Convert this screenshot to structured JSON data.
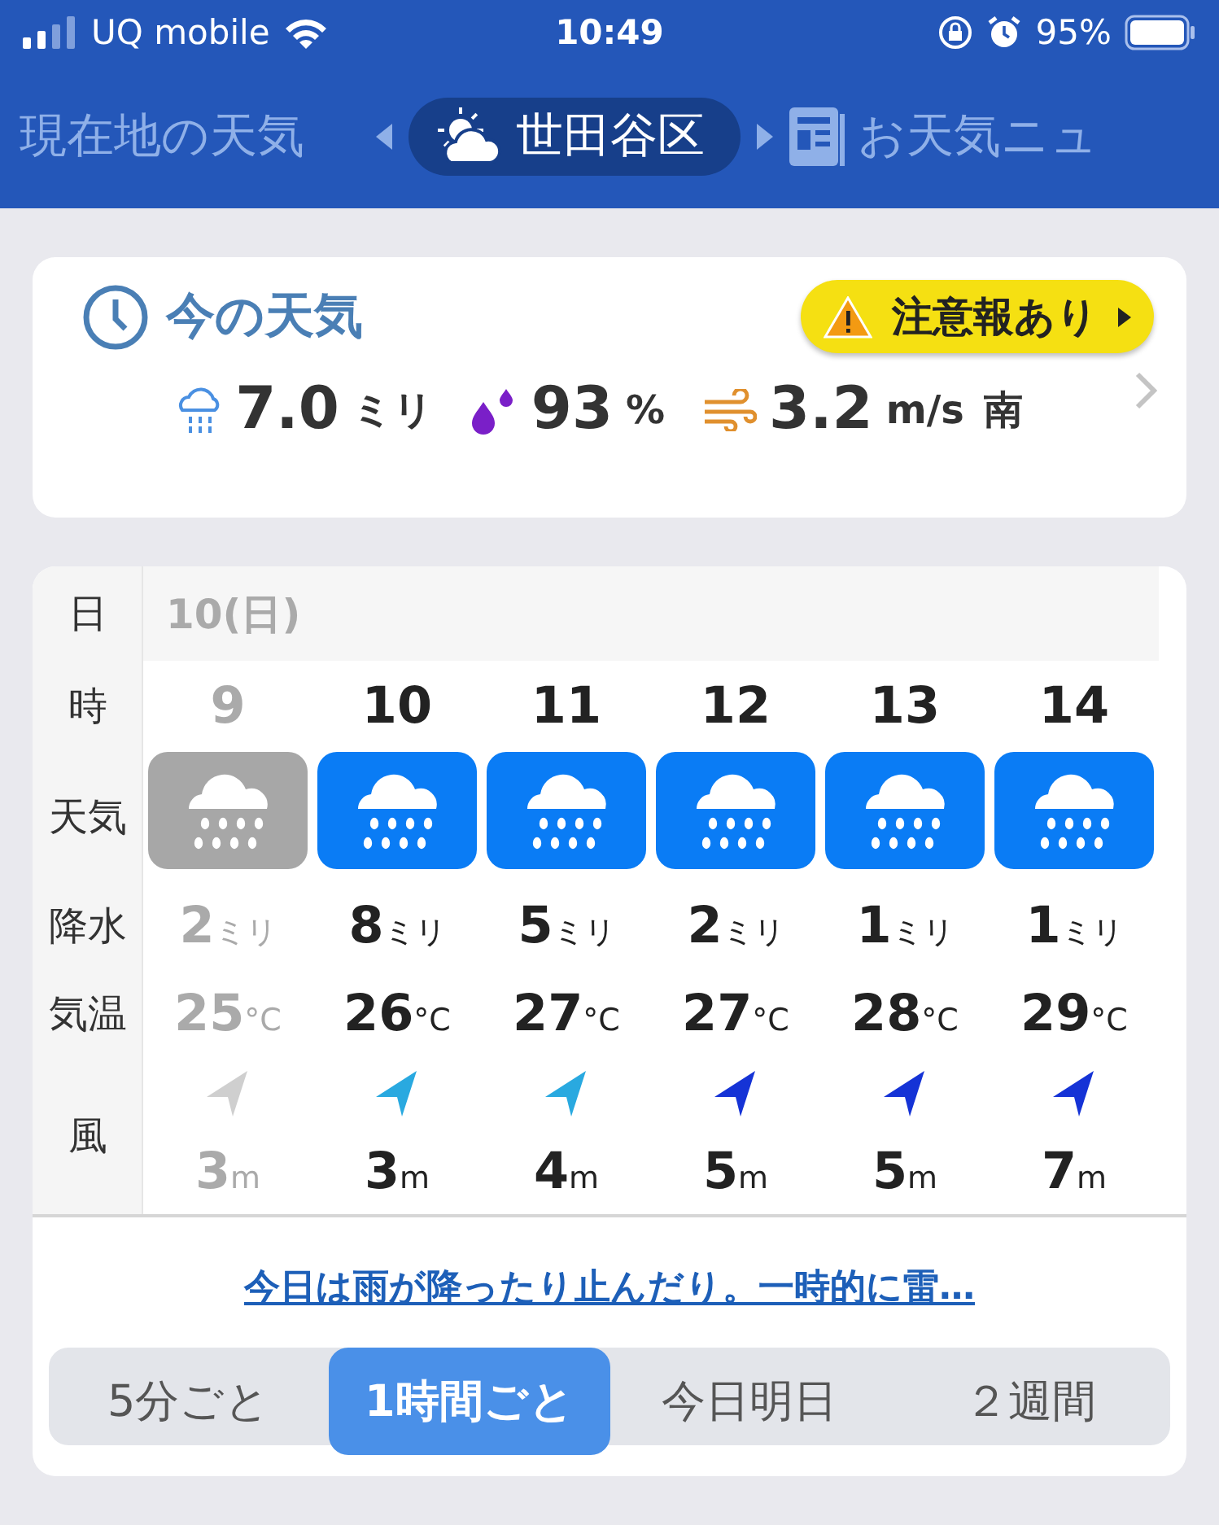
{
  "status_bar": {
    "carrier": "UQ mobile",
    "time": "10:49",
    "battery": "95%"
  },
  "location_tabs": [
    {
      "label": "現在地の天気",
      "kind": "text",
      "selected": false
    },
    {
      "label": "世田谷区",
      "kind": "weather",
      "selected": true
    },
    {
      "label": "お天気ニュ",
      "kind": "news",
      "selected": false
    }
  ],
  "current": {
    "title": "今の天気",
    "alert": "注意報あり",
    "precip": {
      "value": "7.0",
      "unit": "ミリ"
    },
    "humidity": {
      "value": "93",
      "unit": "%"
    },
    "wind": {
      "value": "3.2",
      "unit": "m/s",
      "direction": "南"
    }
  },
  "table": {
    "row_labels": [
      "日",
      "時",
      "天気",
      "降水",
      "気温",
      "風"
    ],
    "date": "10(日)",
    "hours": [
      {
        "hour": "9",
        "past": true,
        "precip": "2",
        "precip_unit": "ミリ",
        "temp": "25",
        "temp_unit": "°C",
        "wind": "3",
        "wind_unit": "m",
        "color": "#cfcfcf"
      },
      {
        "hour": "10",
        "past": false,
        "precip": "8",
        "precip_unit": "ミリ",
        "temp": "26",
        "temp_unit": "°C",
        "wind": "3",
        "wind_unit": "m",
        "color": "#29a9e0"
      },
      {
        "hour": "11",
        "past": false,
        "precip": "5",
        "precip_unit": "ミリ",
        "temp": "27",
        "temp_unit": "°C",
        "wind": "4",
        "wind_unit": "m",
        "color": "#29a9e0"
      },
      {
        "hour": "12",
        "past": false,
        "precip": "2",
        "precip_unit": "ミリ",
        "temp": "27",
        "temp_unit": "°C",
        "wind": "5",
        "wind_unit": "m",
        "color": "#1533d6"
      },
      {
        "hour": "13",
        "past": false,
        "precip": "1",
        "precip_unit": "ミリ",
        "temp": "28",
        "temp_unit": "°C",
        "wind": "5",
        "wind_unit": "m",
        "color": "#1533d6"
      },
      {
        "hour": "14",
        "past": false,
        "precip": "1",
        "precip_unit": "ミリ",
        "temp": "29",
        "temp_unit": "°C",
        "wind": "7",
        "wind_unit": "m",
        "color": "#1533d6"
      }
    ]
  },
  "summary_link": "今日は雨が降ったり止んだり。一時的に雷…",
  "interval_tabs": [
    {
      "label": "5分ごと",
      "selected": false
    },
    {
      "label": "1時間ごと",
      "selected": true
    },
    {
      "label": "今日明日",
      "selected": false
    },
    {
      "label": "２週間",
      "selected": false
    }
  ]
}
